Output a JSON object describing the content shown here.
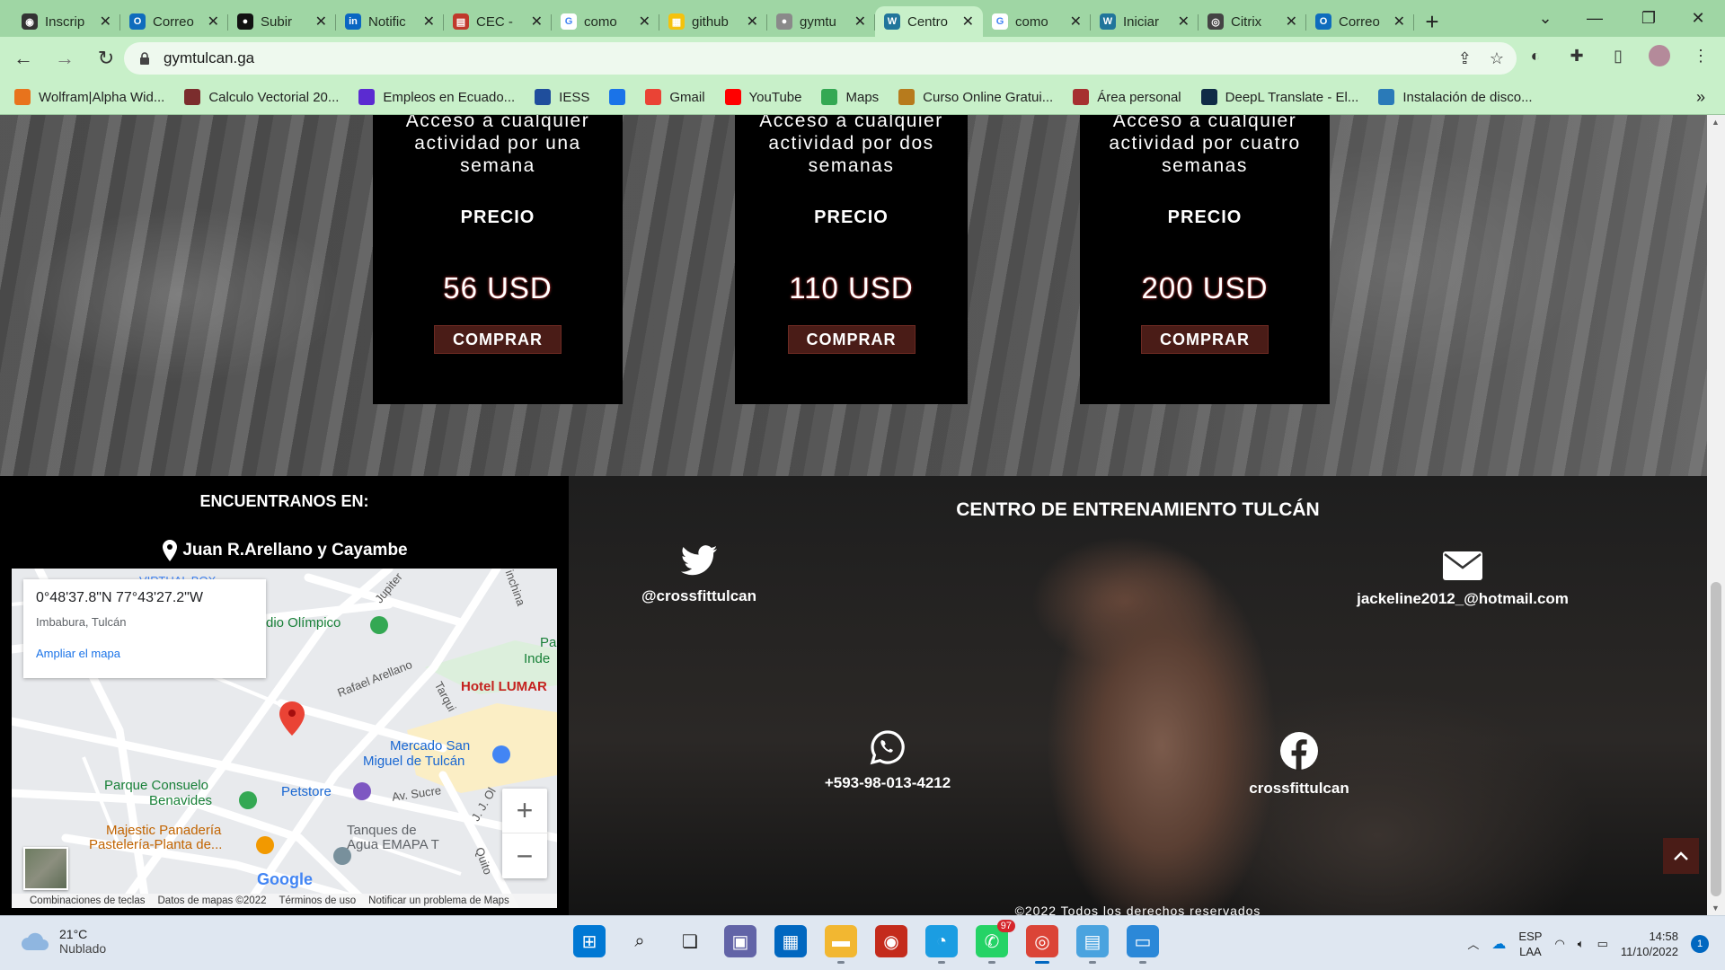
{
  "browser": {
    "tabs": [
      {
        "title": "Inscrip",
        "fav_color": "#333333",
        "fav_glyph": "◉"
      },
      {
        "title": "Correo",
        "fav_color": "#0f6cbd",
        "fav_glyph": "O"
      },
      {
        "title": "Subir",
        "fav_color": "#111111",
        "fav_glyph": "●"
      },
      {
        "title": "Notific",
        "fav_color": "#0a66c2",
        "fav_glyph": "in"
      },
      {
        "title": "CEC -",
        "fav_color": "#c0392b",
        "fav_glyph": "▤"
      },
      {
        "title": "como",
        "fav_color": "#ffffff",
        "fav_glyph": "G"
      },
      {
        "title": "github",
        "fav_color": "#f4c20d",
        "fav_glyph": "▦"
      },
      {
        "title": "gymtu",
        "fav_color": "#8a8a8a",
        "fav_glyph": "●"
      },
      {
        "title": "Centro",
        "fav_color": "#21759b",
        "fav_glyph": "W"
      },
      {
        "title": "como",
        "fav_color": "#ffffff",
        "fav_glyph": "G"
      },
      {
        "title": "Iniciar",
        "fav_color": "#21759b",
        "fav_glyph": "W"
      },
      {
        "title": "Citrix",
        "fav_color": "#444444",
        "fav_glyph": "◎"
      },
      {
        "title": "Correo",
        "fav_color": "#0f6cbd",
        "fav_glyph": "O"
      }
    ],
    "active_tab_index": 8,
    "url": "gymtulcan.ga",
    "bookmarks": [
      {
        "label": "Wolfram|Alpha Wid...",
        "color": "#e8731c"
      },
      {
        "label": "Calculo Vectorial 20...",
        "color": "#7b2d2d"
      },
      {
        "label": "Empleos en Ecuado...",
        "color": "#5b2bd1"
      },
      {
        "label": "IESS",
        "color": "#1f4e9c"
      },
      {
        "label": "",
        "color": "#1a73e8"
      },
      {
        "label": "Gmail",
        "color": "#ea4335"
      },
      {
        "label": "YouTube",
        "color": "#ff0000"
      },
      {
        "label": "Maps",
        "color": "#34a853"
      },
      {
        "label": "Curso Online Gratui...",
        "color": "#b77b1d"
      },
      {
        "label": "Área personal",
        "color": "#a63030"
      },
      {
        "label": "DeepL Translate - El...",
        "color": "#0f2b46"
      },
      {
        "label": "Instalación de disco...",
        "color": "#2a7ab8"
      }
    ]
  },
  "pricing": {
    "plans": [
      {
        "desc": "Acceso a cualquier actividad por una semana",
        "price_label": "PRECIO",
        "amount": "56 USD",
        "buy_label": "COMPRAR"
      },
      {
        "desc": "Acceso a cualquier actividad por dos semanas",
        "price_label": "PRECIO",
        "amount": "110 USD",
        "buy_label": "COMPRAR"
      },
      {
        "desc": "Acceso a cualquier actividad por cuatro semanas",
        "price_label": "PRECIO",
        "amount": "200 USD",
        "buy_label": "COMPRAR"
      }
    ]
  },
  "location": {
    "title": "ENCUENTRANOS EN:",
    "address": "Juan R.Arellano y Cayambe",
    "map": {
      "coords": "0°48'37.8\"N 77°43'27.2\"W",
      "place": "Imbabura, Tulcán",
      "expand_link": "Ampliar el mapa",
      "labels": {
        "virtual": "VIRTUAL BOX",
        "olimpico": "dio Olímpico",
        "jupiter": "Jupiter",
        "inchina": "inchina",
        "pa": "Pa",
        "inde": "Inde",
        "arellano": "Rafael Arellano",
        "tarqui": "Tarqui",
        "hotel": "Hotel LUMAR",
        "mercado1": "Mercado San",
        "mercado2": "Miguel de Tulcán",
        "petstore": "Petstore",
        "sucre": "Av. Sucre",
        "jjol": "J. J. Ol",
        "parque1": "Parque Consuelo",
        "parque2": "Benavides",
        "majestic1": "Majestic Panadería",
        "majestic2": "Pastelería-Planta de...",
        "tanques1": "Tanques de",
        "tanques2": "Agua EMAPA T",
        "quito": "Quito"
      },
      "zoom_in": "+",
      "zoom_out": "−",
      "google": "Google",
      "footer": [
        "Combinaciones de teclas",
        "Datos de mapas ©2022",
        "Términos de uso",
        "Notificar un problema de Maps"
      ]
    }
  },
  "contact": {
    "title": "CENTRO DE ENTRENAMIENTO TULCÁN",
    "twitter": "@crossfittulcan",
    "email": "jackeline2012_@hotmail.com",
    "whatsapp": "+593-98-013-4212",
    "facebook": "crossfittulcan",
    "copyright": "©2022 Todos los derechos reservados"
  },
  "taskbar": {
    "weather_temp": "21°C",
    "weather_desc": "Nublado",
    "apps": [
      "start-icon",
      "search-icon",
      "task-view-icon",
      "teams-icon",
      "store-icon",
      "file-explorer-icon",
      "screen-recorder-icon",
      "edge-icon",
      "whatsapp-icon",
      "chrome-icon",
      "notepad-icon",
      "remote-desktop-icon"
    ],
    "whatsapp_badge": "97",
    "lang1": "ESP",
    "lang2": "LAA",
    "time": "14:58",
    "date": "11/10/2022",
    "notifications": "1"
  }
}
